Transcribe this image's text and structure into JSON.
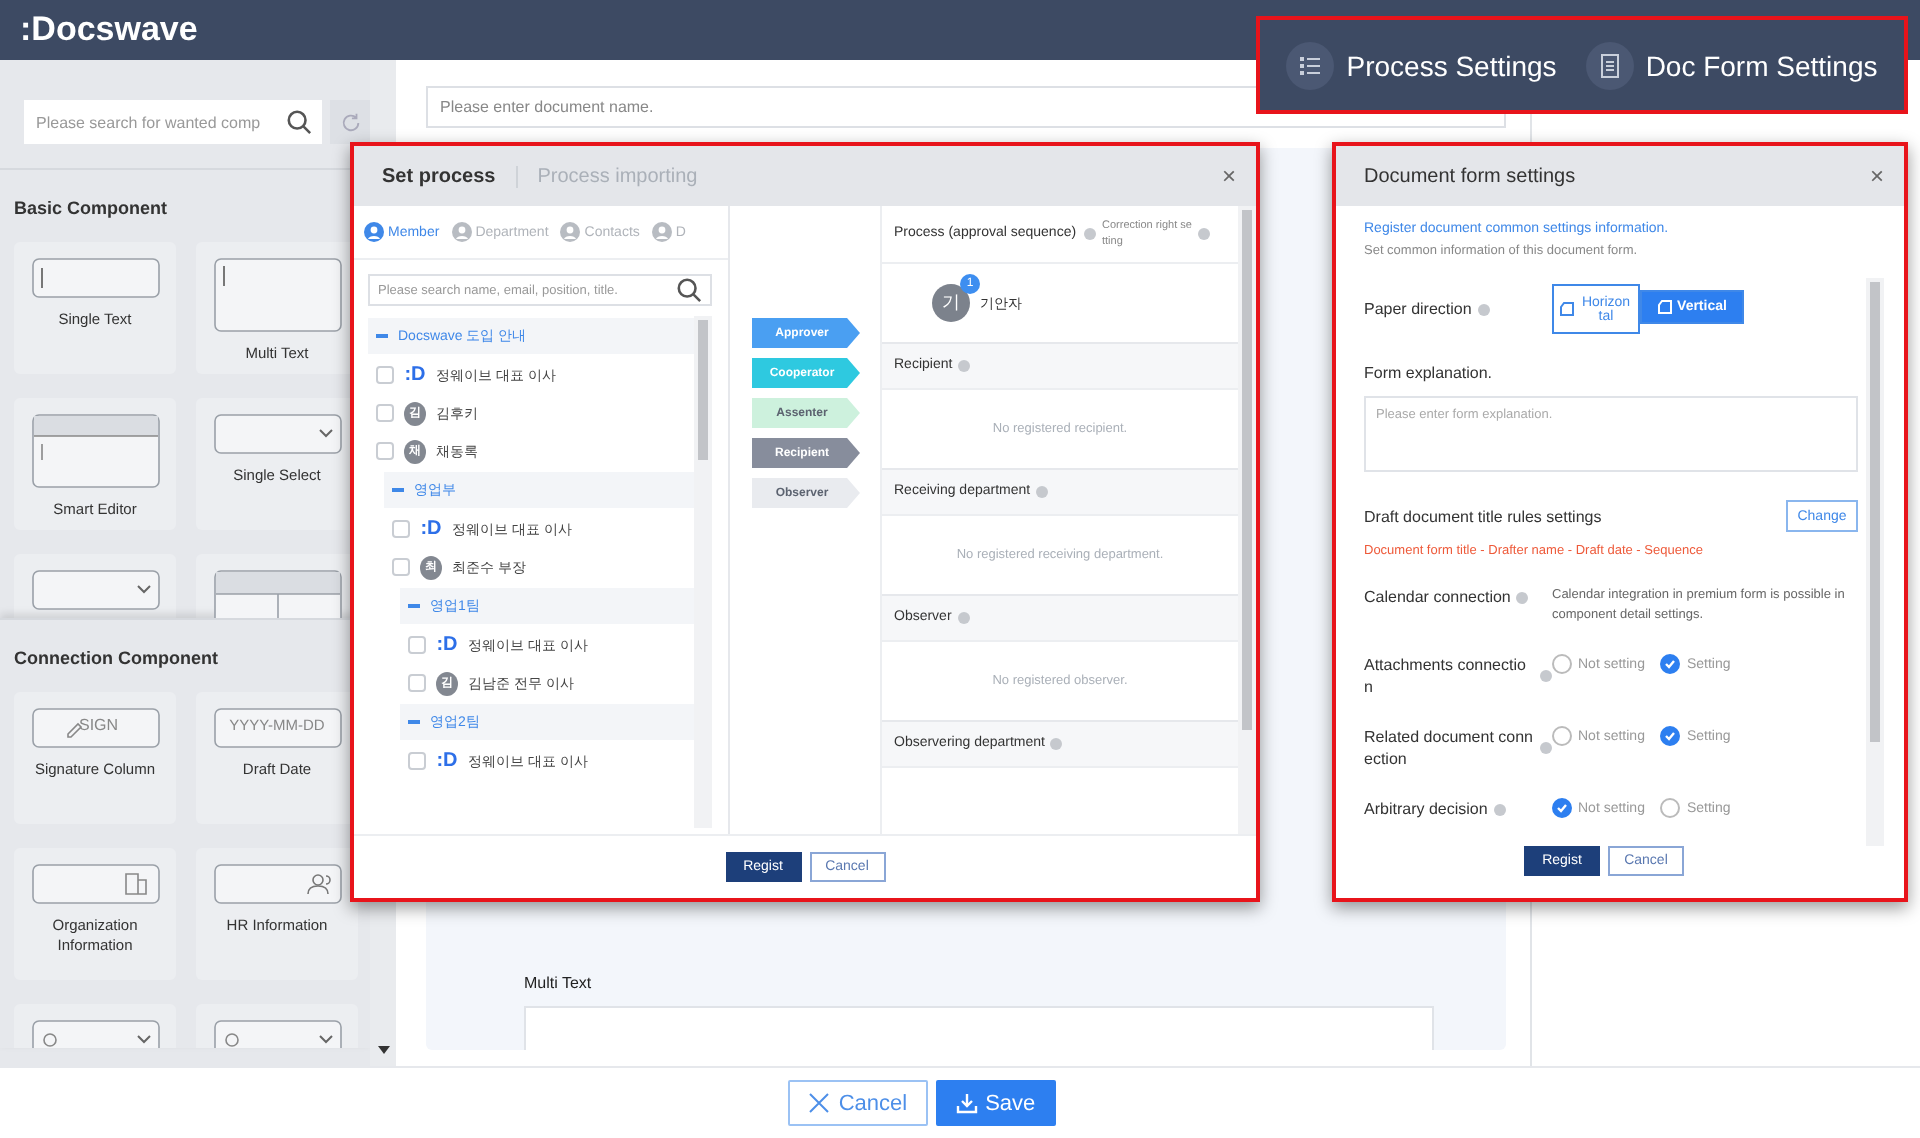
{
  "header": {
    "logo": ":Docswave"
  },
  "sidebar": {
    "search_placeholder": "Please search for wanted comp",
    "sections": [
      {
        "title": "Basic Component",
        "items": [
          {
            "kind": "single_text",
            "label": "Single Text"
          },
          {
            "kind": "multi_text",
            "label": "Multi Text"
          },
          {
            "kind": "smart_editor",
            "label": "Smart Editor"
          },
          {
            "kind": "single_select",
            "label": "Single Select"
          },
          {
            "kind": "select_table"
          },
          {
            "kind": "table"
          }
        ]
      },
      {
        "title": "Connection Component",
        "items": [
          {
            "kind": "sign",
            "label": "Signature Column",
            "preview": "SIGN"
          },
          {
            "kind": "date",
            "label": "Draft Date",
            "preview": "YYYY-MM-DD"
          },
          {
            "kind": "org",
            "label": "Organization Information"
          },
          {
            "kind": "hr",
            "label": "HR Information"
          },
          {
            "kind": "refresh_select"
          },
          {
            "kind": "edit_select"
          }
        ]
      }
    ]
  },
  "document": {
    "name_placeholder": "Please enter document name.",
    "field_label": "Multi Text"
  },
  "footer": {
    "cancel": "Cancel",
    "save": "Save"
  },
  "settings_buttons": [
    {
      "kind": "process",
      "label": "Process Settings"
    },
    {
      "kind": "doc_form",
      "label": "Doc Form Settings"
    }
  ],
  "process_dialog": {
    "tabs": [
      {
        "label": "Set process",
        "selected": true
      },
      {
        "label": "Process importing",
        "selected": false
      }
    ],
    "close": "×",
    "sub_tabs": [
      {
        "label": "Member",
        "selected": true
      },
      {
        "label": "Department",
        "selected": false
      },
      {
        "label": "Contacts",
        "selected": false
      },
      {
        "label": "D",
        "selected": false
      }
    ],
    "search_placeholder": "Please search name, email, position, title.",
    "tree": [
      {
        "label": "Docswave 도입 안내",
        "expanded": true,
        "children": [
          {
            "name": "정웨이브 대표 이사",
            "kind": "logo",
            "avatar": ":D",
            "checked": false
          },
          {
            "name": "김후키",
            "kind": "initial",
            "avatar": "김",
            "checked": false
          },
          {
            "name": "채동록",
            "kind": "initial",
            "avatar": "채",
            "checked": false
          },
          {
            "label": "영업부",
            "expanded": true,
            "children": [
              {
                "name": "정웨이브 대표 이사",
                "kind": "logo",
                "avatar": ":D",
                "checked": false
              },
              {
                "name": "최준수 부장",
                "kind": "initial",
                "avatar": "최",
                "checked": false
              },
              {
                "label": "영업1팀",
                "expanded": true,
                "children": [
                  {
                    "name": "정웨이브 대표 이사",
                    "kind": "logo",
                    "avatar": ":D",
                    "checked": false
                  },
                  {
                    "name": "김남준 전무 이사",
                    "kind": "initial",
                    "avatar": "김",
                    "checked": false
                  }
                ]
              },
              {
                "label": "영업2팀",
                "expanded": true,
                "children": [
                  {
                    "name": "정웨이브 대표 이사",
                    "kind": "logo",
                    "avatar": ":D",
                    "checked": false
                  }
                ]
              }
            ]
          }
        ]
      }
    ],
    "roles": [
      {
        "label": "Approver",
        "color": "#4a9ff2"
      },
      {
        "label": "Cooperator",
        "color": "#2ec9e0"
      },
      {
        "label": "Assenter",
        "color": "#cdf1dd"
      },
      {
        "label": "Recipient",
        "color": "#878d9c"
      },
      {
        "label": "Observer",
        "color": "#e9ebef"
      }
    ],
    "process_title": "Process (approval sequence)",
    "correction_label": "Correction right setting",
    "approvers": [
      {
        "avatar": "기",
        "badge": "1",
        "name": "기안자"
      }
    ],
    "sections": [
      {
        "title": "Recipient",
        "empty": "No registered recipient."
      },
      {
        "title": "Receiving department",
        "empty": "No registered receiving department."
      },
      {
        "title": "Observer",
        "empty": "No registered observer."
      },
      {
        "title": "Observering department"
      }
    ],
    "buttons": {
      "ok": "Regist",
      "cancel": "Cancel"
    }
  },
  "doc_form_dialog": {
    "title": "Document form settings",
    "close": "×",
    "intro": "Register document common settings information.",
    "subintro": "Set common information of this document form.",
    "rows": [
      {
        "kind": "toggle",
        "label": "Paper direction",
        "options": [
          {
            "label": "Horizontal",
            "selected": false
          },
          {
            "label": "Vertical",
            "selected": true
          }
        ]
      },
      {
        "kind": "textarea",
        "label": "Form explanation.",
        "placeholder": "Please enter form explanation."
      },
      {
        "kind": "rule",
        "label": "Draft document title rules settings",
        "button": "Change",
        "rule": "Document form title - Drafter name - Draft date - Sequence"
      },
      {
        "kind": "note",
        "label": "Calendar connection",
        "note": "Calendar integration in premium form is possible in component detail settings."
      },
      {
        "kind": "radio",
        "label": "Attachments connection",
        "options": [
          {
            "label": "Not setting",
            "selected": false
          },
          {
            "label": "Setting",
            "selected": true
          }
        ]
      },
      {
        "kind": "radio",
        "label": "Related document connection",
        "options": [
          {
            "label": "Not setting",
            "selected": false
          },
          {
            "label": "Setting",
            "selected": true
          }
        ]
      },
      {
        "kind": "radio",
        "label": "Arbitrary decision",
        "options": [
          {
            "label": "Not setting",
            "selected": true
          },
          {
            "label": "Setting",
            "selected": false
          }
        ]
      }
    ],
    "buttons": {
      "ok": "Regist",
      "cancel": "Cancel"
    }
  }
}
